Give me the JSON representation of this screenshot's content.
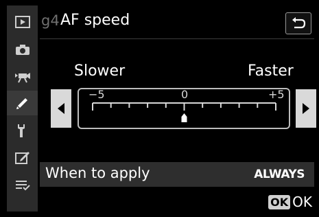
{
  "header": {
    "code": "g4",
    "title": "AF speed"
  },
  "sidebar": {
    "items": [
      {
        "icon": "playback-icon"
      },
      {
        "icon": "camera-icon"
      },
      {
        "icon": "movie-camera-icon"
      },
      {
        "icon": "pencil-icon",
        "active": true
      },
      {
        "icon": "wrench-icon"
      },
      {
        "icon": "retouch-icon"
      },
      {
        "icon": "my-menu-icon"
      }
    ]
  },
  "slider": {
    "left_label": "Slower",
    "right_label": "Faster",
    "min_label": "−5",
    "mid_label": "0",
    "max_label": "+5",
    "value": 0,
    "min": -5,
    "max": 5
  },
  "row": {
    "label": "When to apply",
    "value": "ALWAYS"
  },
  "footer": {
    "ok_badge": "OK",
    "ok_text": "OK"
  }
}
